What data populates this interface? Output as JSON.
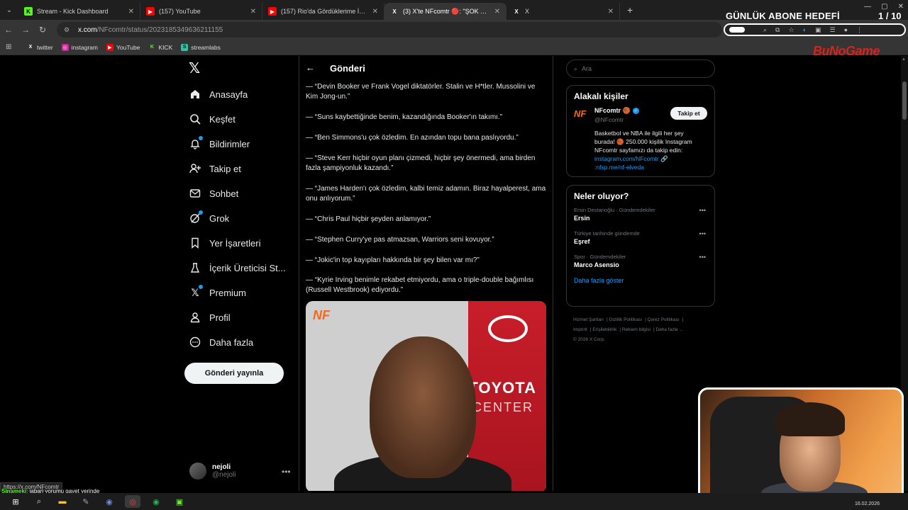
{
  "browser": {
    "tabs": [
      {
        "label": "Stream - Kick Dashboard",
        "fav": "K",
        "color": "#53fc18",
        "text": "#000"
      },
      {
        "label": "(157) YouTube",
        "fav": "▶",
        "color": "#ff0000",
        "text": "#fff"
      },
      {
        "label": "(157) Rio'da Gördüklerime İnan",
        "fav": "▶",
        "color": "#ff0000",
        "text": "#fff"
      },
      {
        "label": "(3) X'te NFcomtr 🔴: \"ŞOK ŞOK",
        "fav": "X",
        "color": "#000",
        "text": "#fff"
      },
      {
        "label": "X",
        "fav": "X",
        "color": "#000",
        "text": "#fff"
      }
    ],
    "url_host": "x.com",
    "url_path": "/NFcomtr/status/2023185349636211155",
    "bookmarks": [
      {
        "label": "twitter",
        "icon": "X",
        "color": "#000"
      },
      {
        "label": "instagram",
        "icon": "◎",
        "color": "#d6249f"
      },
      {
        "label": "YouTube",
        "icon": "▶",
        "color": "#ff0000"
      },
      {
        "label": "KICK",
        "icon": "K",
        "color": "#53fc18"
      },
      {
        "label": "streamlabs",
        "icon": "S",
        "color": "#31c3a2"
      }
    ],
    "status_url": "https://x.com/NFcomtr"
  },
  "overlay": {
    "goal_title": "GÜNLÜK ABONE HEDEFİ",
    "goal_count": "1 / 10",
    "brand": "BuNoGame",
    "chat_user": "Sinameki",
    "chat_message": ": jabari yorumu gayet yerinde"
  },
  "nav": {
    "items": [
      {
        "label": "Anasayfa",
        "icon": "home-icon"
      },
      {
        "label": "Keşfet",
        "icon": "search-icon"
      },
      {
        "label": "Bildirimler",
        "icon": "bell-icon"
      },
      {
        "label": "Takip et",
        "icon": "follow-icon"
      },
      {
        "label": "Sohbet",
        "icon": "mail-icon"
      },
      {
        "label": "Grok",
        "icon": "grok-icon"
      },
      {
        "label": "Yer İşaretleri",
        "icon": "bookmark-icon"
      },
      {
        "label": "İçerik Üreticisi St...",
        "icon": "creator-icon"
      },
      {
        "label": "Premium",
        "icon": "x-premium-icon"
      },
      {
        "label": "Profil",
        "icon": "profile-icon"
      },
      {
        "label": "Daha fazla",
        "icon": "more-icon"
      }
    ],
    "post_button": "Gönderi yayınla",
    "account_name": "nejoli",
    "account_handle": "@nejoli"
  },
  "main": {
    "title": "Gönderi",
    "quotes": [
      "— “Devin Booker ve Frank Vogel diktatörler. Stalin ve H*tler. Mussolini ve Kim Jong-un.”",
      "— “Suns kaybettiğinde benim, kazandığında Booker'ın takımı.”",
      "— “Ben Simmons'u çok özledim. En azından topu bana paslıyordu.”",
      "— “Steve Kerr hiçbir oyun planı çizmedi, hiçbir şey önermedi, ama birden fazla şampiyonluk kazandı.”",
      "— “James Harden'ı çok özledim, kalbi temiz adamın. Biraz hayalperest, ama onu anlıyorum.”",
      "— “Chris Paul hiçbir şeyden anlamıyor.”",
      "— “Stephen Curry'ye pas atmazsan, Warriors seni kovuyor.”",
      "— “Jokic'in top kayıpları hakkında bir şey bilen var mı?”",
      "— “Kyrie Irving benimle rekabet etmiyordu, ama o triple-double bağımlısı (Russell Westbrook) ediyordu.”"
    ],
    "media_logo": "NF",
    "media_sponsor": "TOYOTA",
    "media_sponsor2": "CENTER"
  },
  "sidebar": {
    "search_placeholder": "Ara",
    "related_title": "Alakalı kişiler",
    "related": {
      "logo": "NF",
      "name": "NFcomtr 🏀",
      "handle": "@NFcomtr",
      "follow": "Takip et",
      "bio": "Basketbol ve NBA ile ilgili her şey burada! 🏀 250.000 kişilik Instagram NFcomtr sayfamızı da takip edin:",
      "link1": "instagram.com/NFcomtr 🔗",
      "link2": ":nfsp.me/nf-elveda"
    },
    "trends_title": "Neler oluyor?",
    "trends": [
      {
        "meta": "Ersin Destanoğlu · Gündemdekiler",
        "name": "Ersin"
      },
      {
        "meta": "Türkiye tarihinde gündemde",
        "name": "Eşref"
      },
      {
        "meta": "Spor · Gündemdekiler",
        "name": "Marco Asensio"
      }
    ],
    "show_more": "Daha fazla göster",
    "footer": [
      "Hizmet Şartları",
      "Gizlilik Politikası",
      "Çerez Politikası",
      "Imprint",
      "Erişilebilirlik",
      "Reklam bilgisi",
      "Daha fazla ...",
      "© 2026 X Corp."
    ]
  },
  "taskbar": {
    "date": "16.02.2026"
  }
}
